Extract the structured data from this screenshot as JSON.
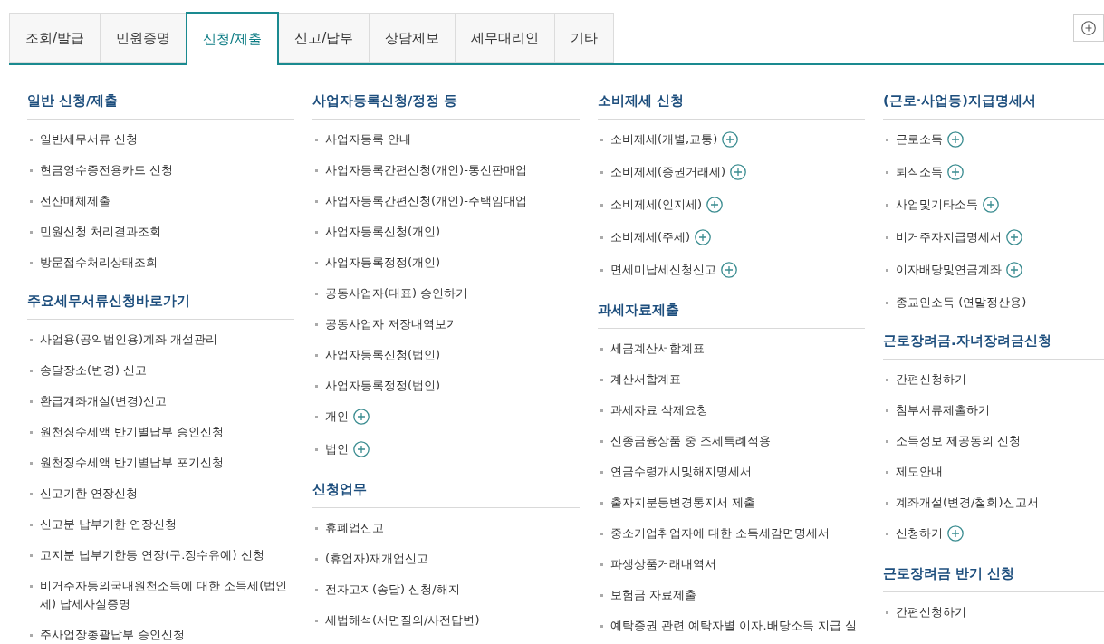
{
  "tabs": [
    {
      "label": "조회/발급",
      "selected": false
    },
    {
      "label": "민원증명",
      "selected": false
    },
    {
      "label": "신청/제출",
      "selected": true
    },
    {
      "label": "신고/납부",
      "selected": false
    },
    {
      "label": "상담제보",
      "selected": false
    },
    {
      "label": "세무대리인",
      "selected": false
    },
    {
      "label": "기타",
      "selected": false
    }
  ],
  "columns": [
    {
      "sections": [
        {
          "heading": "일반 신청/제출",
          "items": [
            {
              "label": "일반세무서류 신청",
              "expandable": false
            },
            {
              "label": "현금영수증전용카드 신청",
              "expandable": false
            },
            {
              "label": "전산매체제출",
              "expandable": false
            },
            {
              "label": "민원신청 처리결과조회",
              "expandable": false
            },
            {
              "label": "방문접수처리상태조회",
              "expandable": false
            }
          ]
        },
        {
          "heading": "주요세무서류신청바로가기",
          "items": [
            {
              "label": "사업용(공익법인용)계좌 개설관리",
              "expandable": false
            },
            {
              "label": "송달장소(변경) 신고",
              "expandable": false
            },
            {
              "label": "환급계좌개설(변경)신고",
              "expandable": false
            },
            {
              "label": "원천징수세액 반기별납부 승인신청",
              "expandable": false
            },
            {
              "label": "원천징수세액 반기별납부 포기신청",
              "expandable": false
            },
            {
              "label": "신고기한 연장신청",
              "expandable": false
            },
            {
              "label": "신고분 납부기한 연장신청",
              "expandable": false
            },
            {
              "label": "고지분 납부기한등 연장(구.징수유예) 신청",
              "expandable": false
            },
            {
              "label": "비거주자등의국내원천소득에 대한 소득세(법인세) 납세사실증명",
              "expandable": false
            },
            {
              "label": "주사업장총괄납부 승인신청",
              "expandable": false
            }
          ]
        }
      ]
    },
    {
      "sections": [
        {
          "heading": "사업자등록신청/정정 등",
          "items": [
            {
              "label": "사업자등록 안내",
              "expandable": false
            },
            {
              "label": "사업자등록간편신청(개인)-통신판매업",
              "expandable": false
            },
            {
              "label": "사업자등록간편신청(개인)-주택임대업",
              "expandable": false
            },
            {
              "label": "사업자등록신청(개인)",
              "expandable": false
            },
            {
              "label": "사업자등록정정(개인)",
              "expandable": false
            },
            {
              "label": "공동사업자(대표) 승인하기",
              "expandable": false
            },
            {
              "label": "공동사업자 저장내역보기",
              "expandable": false
            },
            {
              "label": "사업자등록신청(법인)",
              "expandable": false
            },
            {
              "label": "사업자등록정정(법인)",
              "expandable": false
            },
            {
              "label": "개인",
              "expandable": true
            },
            {
              "label": "법인",
              "expandable": true
            }
          ]
        },
        {
          "heading": "신청업무",
          "items": [
            {
              "label": "휴폐업신고",
              "expandable": false
            },
            {
              "label": "(휴업자)재개업신고",
              "expandable": false
            },
            {
              "label": "전자고지(송달) 신청/해지",
              "expandable": false
            },
            {
              "label": "세법해석(서면질의/사전답변)",
              "expandable": false
            }
          ]
        }
      ]
    },
    {
      "sections": [
        {
          "heading": "소비제세 신청",
          "items": [
            {
              "label": "소비제세(개별,교통)",
              "expandable": true
            },
            {
              "label": "소비제세(증권거래세)",
              "expandable": true
            },
            {
              "label": "소비제세(인지세)",
              "expandable": true
            },
            {
              "label": "소비제세(주세)",
              "expandable": true
            },
            {
              "label": "면세미납세신청신고",
              "expandable": true
            }
          ]
        },
        {
          "heading": "과세자료제출",
          "items": [
            {
              "label": "세금계산서합계표",
              "expandable": false
            },
            {
              "label": "계산서합계표",
              "expandable": false
            },
            {
              "label": "과세자료 삭제요청",
              "expandable": false
            },
            {
              "label": "신종금융상품 중 조세특례적용",
              "expandable": false
            },
            {
              "label": "연금수령개시및해지명세서",
              "expandable": false
            },
            {
              "label": "출자지분등변경통지서 제출",
              "expandable": false
            },
            {
              "label": "중소기업취업자에 대한 소득세감면명세서",
              "expandable": false
            },
            {
              "label": "파생상품거래내역서",
              "expandable": false
            },
            {
              "label": "보험금 자료제출",
              "expandable": false
            },
            {
              "label": "예탁증권 관련 예탁자별 이자.배당소득 지급 실",
              "expandable": false
            }
          ]
        }
      ]
    },
    {
      "sections": [
        {
          "heading": "(근로·사업등)지급명세서",
          "items": [
            {
              "label": "근로소득",
              "expandable": true
            },
            {
              "label": "퇴직소득",
              "expandable": true
            },
            {
              "label": "사업및기타소득",
              "expandable": true
            },
            {
              "label": "비거주자지급명세서",
              "expandable": true
            },
            {
              "label": "이자배당및연금계좌",
              "expandable": true
            },
            {
              "label": "종교인소득 (연말정산용)",
              "expandable": false
            }
          ]
        },
        {
          "heading": "근로장려금.자녀장려금신청",
          "items": [
            {
              "label": "간편신청하기",
              "expandable": false
            },
            {
              "label": "첨부서류제출하기",
              "expandable": false
            },
            {
              "label": "소득정보 제공동의 신청",
              "expandable": false
            },
            {
              "label": "제도안내",
              "expandable": false
            },
            {
              "label": "계좌개설(변경/철회)신고서",
              "expandable": false
            },
            {
              "label": "신청하기",
              "expandable": true
            }
          ]
        },
        {
          "heading": "근로장려금 반기 신청",
          "items": [
            {
              "label": "간편신청하기",
              "expandable": false
            }
          ]
        }
      ]
    }
  ]
}
